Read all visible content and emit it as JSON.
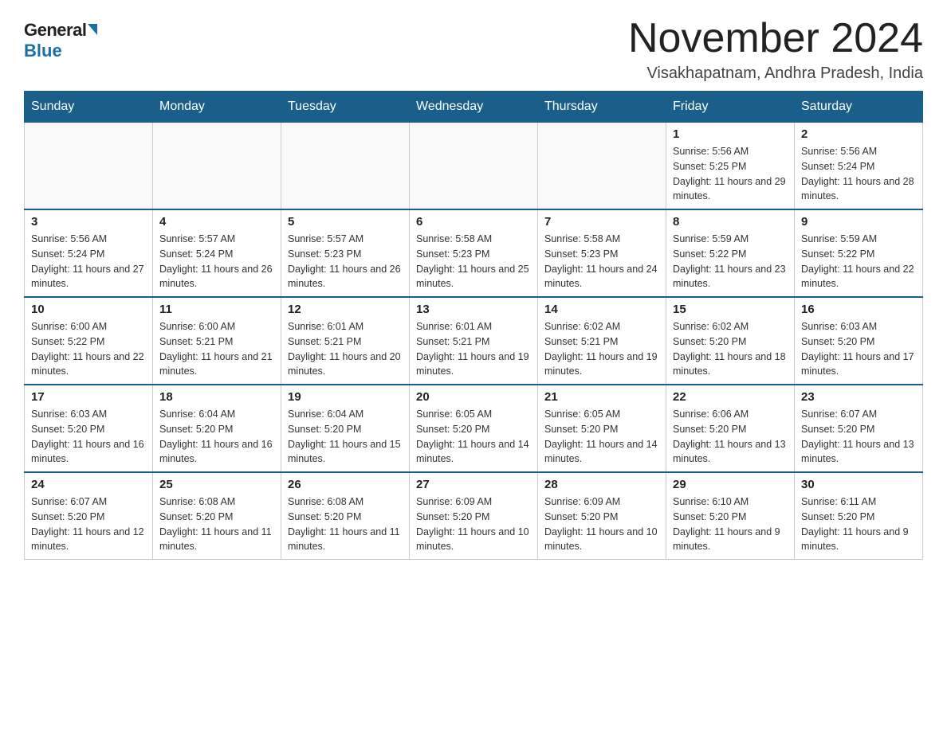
{
  "logo": {
    "general": "General",
    "blue": "Blue"
  },
  "header": {
    "month_year": "November 2024",
    "location": "Visakhapatnam, Andhra Pradesh, India"
  },
  "days_of_week": [
    "Sunday",
    "Monday",
    "Tuesday",
    "Wednesday",
    "Thursday",
    "Friday",
    "Saturday"
  ],
  "weeks": [
    [
      {
        "day": "",
        "info": ""
      },
      {
        "day": "",
        "info": ""
      },
      {
        "day": "",
        "info": ""
      },
      {
        "day": "",
        "info": ""
      },
      {
        "day": "",
        "info": ""
      },
      {
        "day": "1",
        "info": "Sunrise: 5:56 AM\nSunset: 5:25 PM\nDaylight: 11 hours and 29 minutes."
      },
      {
        "day": "2",
        "info": "Sunrise: 5:56 AM\nSunset: 5:24 PM\nDaylight: 11 hours and 28 minutes."
      }
    ],
    [
      {
        "day": "3",
        "info": "Sunrise: 5:56 AM\nSunset: 5:24 PM\nDaylight: 11 hours and 27 minutes."
      },
      {
        "day": "4",
        "info": "Sunrise: 5:57 AM\nSunset: 5:24 PM\nDaylight: 11 hours and 26 minutes."
      },
      {
        "day": "5",
        "info": "Sunrise: 5:57 AM\nSunset: 5:23 PM\nDaylight: 11 hours and 26 minutes."
      },
      {
        "day": "6",
        "info": "Sunrise: 5:58 AM\nSunset: 5:23 PM\nDaylight: 11 hours and 25 minutes."
      },
      {
        "day": "7",
        "info": "Sunrise: 5:58 AM\nSunset: 5:23 PM\nDaylight: 11 hours and 24 minutes."
      },
      {
        "day": "8",
        "info": "Sunrise: 5:59 AM\nSunset: 5:22 PM\nDaylight: 11 hours and 23 minutes."
      },
      {
        "day": "9",
        "info": "Sunrise: 5:59 AM\nSunset: 5:22 PM\nDaylight: 11 hours and 22 minutes."
      }
    ],
    [
      {
        "day": "10",
        "info": "Sunrise: 6:00 AM\nSunset: 5:22 PM\nDaylight: 11 hours and 22 minutes."
      },
      {
        "day": "11",
        "info": "Sunrise: 6:00 AM\nSunset: 5:21 PM\nDaylight: 11 hours and 21 minutes."
      },
      {
        "day": "12",
        "info": "Sunrise: 6:01 AM\nSunset: 5:21 PM\nDaylight: 11 hours and 20 minutes."
      },
      {
        "day": "13",
        "info": "Sunrise: 6:01 AM\nSunset: 5:21 PM\nDaylight: 11 hours and 19 minutes."
      },
      {
        "day": "14",
        "info": "Sunrise: 6:02 AM\nSunset: 5:21 PM\nDaylight: 11 hours and 19 minutes."
      },
      {
        "day": "15",
        "info": "Sunrise: 6:02 AM\nSunset: 5:20 PM\nDaylight: 11 hours and 18 minutes."
      },
      {
        "day": "16",
        "info": "Sunrise: 6:03 AM\nSunset: 5:20 PM\nDaylight: 11 hours and 17 minutes."
      }
    ],
    [
      {
        "day": "17",
        "info": "Sunrise: 6:03 AM\nSunset: 5:20 PM\nDaylight: 11 hours and 16 minutes."
      },
      {
        "day": "18",
        "info": "Sunrise: 6:04 AM\nSunset: 5:20 PM\nDaylight: 11 hours and 16 minutes."
      },
      {
        "day": "19",
        "info": "Sunrise: 6:04 AM\nSunset: 5:20 PM\nDaylight: 11 hours and 15 minutes."
      },
      {
        "day": "20",
        "info": "Sunrise: 6:05 AM\nSunset: 5:20 PM\nDaylight: 11 hours and 14 minutes."
      },
      {
        "day": "21",
        "info": "Sunrise: 6:05 AM\nSunset: 5:20 PM\nDaylight: 11 hours and 14 minutes."
      },
      {
        "day": "22",
        "info": "Sunrise: 6:06 AM\nSunset: 5:20 PM\nDaylight: 11 hours and 13 minutes."
      },
      {
        "day": "23",
        "info": "Sunrise: 6:07 AM\nSunset: 5:20 PM\nDaylight: 11 hours and 13 minutes."
      }
    ],
    [
      {
        "day": "24",
        "info": "Sunrise: 6:07 AM\nSunset: 5:20 PM\nDaylight: 11 hours and 12 minutes."
      },
      {
        "day": "25",
        "info": "Sunrise: 6:08 AM\nSunset: 5:20 PM\nDaylight: 11 hours and 11 minutes."
      },
      {
        "day": "26",
        "info": "Sunrise: 6:08 AM\nSunset: 5:20 PM\nDaylight: 11 hours and 11 minutes."
      },
      {
        "day": "27",
        "info": "Sunrise: 6:09 AM\nSunset: 5:20 PM\nDaylight: 11 hours and 10 minutes."
      },
      {
        "day": "28",
        "info": "Sunrise: 6:09 AM\nSunset: 5:20 PM\nDaylight: 11 hours and 10 minutes."
      },
      {
        "day": "29",
        "info": "Sunrise: 6:10 AM\nSunset: 5:20 PM\nDaylight: 11 hours and 9 minutes."
      },
      {
        "day": "30",
        "info": "Sunrise: 6:11 AM\nSunset: 5:20 PM\nDaylight: 11 hours and 9 minutes."
      }
    ]
  ]
}
